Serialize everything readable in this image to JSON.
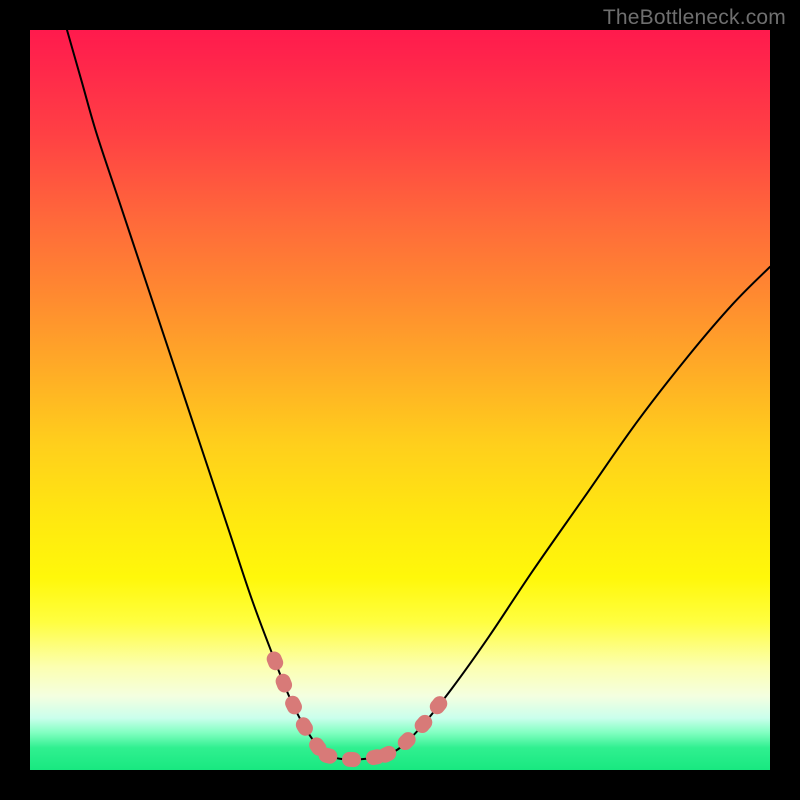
{
  "watermark": {
    "text": "TheBottleneck.com"
  },
  "chart_data": {
    "type": "line",
    "title": "",
    "xlabel": "",
    "ylabel": "",
    "xlim": [
      0,
      100
    ],
    "ylim": [
      0,
      100
    ],
    "grid": false,
    "legend": false,
    "annotations": [],
    "series": [
      {
        "name": "left-curve",
        "x": [
          5,
          7,
          9,
          12,
          15,
          18,
          21,
          24,
          27,
          30,
          33,
          35,
          37,
          39,
          40
        ],
        "y": [
          100,
          93,
          86,
          77,
          68,
          59,
          50,
          41,
          32,
          23,
          15,
          10,
          6,
          3,
          2
        ]
      },
      {
        "name": "right-curve",
        "x": [
          48,
          50,
          53,
          57,
          62,
          68,
          75,
          82,
          89,
          95,
          100
        ],
        "y": [
          2,
          3,
          6,
          11,
          18,
          27,
          37,
          47,
          56,
          63,
          68
        ]
      },
      {
        "name": "valley-floor",
        "x": [
          40,
          42,
          44,
          46,
          48
        ],
        "y": [
          2,
          1.5,
          1.4,
          1.6,
          2
        ]
      }
    ],
    "highlight_segments": [
      {
        "on": "left-curve",
        "x_range": [
          33,
          40
        ]
      },
      {
        "on": "valley-floor",
        "x_range": [
          40,
          48
        ]
      },
      {
        "on": "right-curve",
        "x_range": [
          48,
          56
        ]
      }
    ],
    "background_gradient": {
      "direction": "vertical",
      "stops": [
        {
          "pos": 0.0,
          "color": "#ff1a4d"
        },
        {
          "pos": 0.5,
          "color": "#ffc61c"
        },
        {
          "pos": 0.8,
          "color": "#fffe40"
        },
        {
          "pos": 0.93,
          "color": "#caffec"
        },
        {
          "pos": 1.0,
          "color": "#18e880"
        }
      ]
    }
  }
}
